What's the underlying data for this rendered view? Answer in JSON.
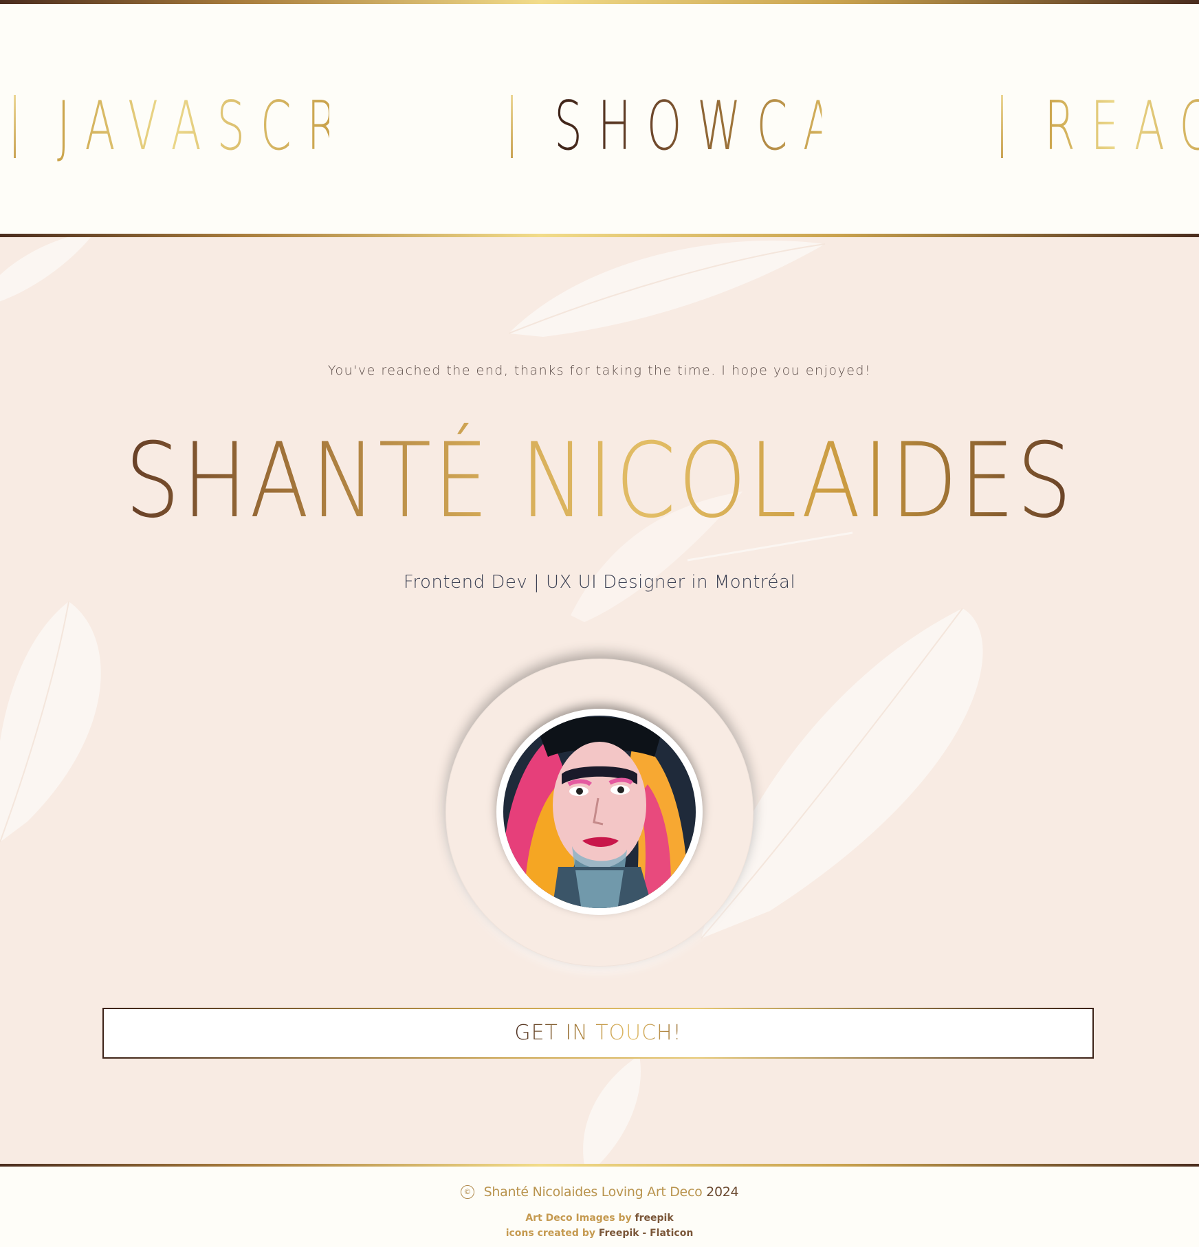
{
  "marquee": {
    "words": [
      "JAVASCRIPT",
      "SHOWCASE",
      "REACT"
    ]
  },
  "hero": {
    "thanks_text": "You've reached the end, thanks for taking the time. I hope you enjoyed!",
    "name": "SHANTÉ NICOLAIDES",
    "subtitle": "Frontend Dev | UX UI Designer in Montréal",
    "cta_label": "GET IN TOUCH!"
  },
  "footer": {
    "copyright_symbol": "©",
    "copyright_name": "Shanté Nicolaides Loving Art Deco",
    "copyright_year": "2024",
    "credit_line_1_prefix": "Art Deco Images by",
    "credit_line_1_link": "freepik",
    "credit_line_2_prefix": "icons created by",
    "credit_line_2_link": "Freepik - Flaticon"
  },
  "colors": {
    "gold": "#d6ac58",
    "brown": "#4a2c1e",
    "hero_bg": "#f8ebe3",
    "band_bg": "#fefdf8"
  },
  "icons": [
    "copyright-icon",
    "feather-decoration",
    "portrait-avatar"
  ]
}
